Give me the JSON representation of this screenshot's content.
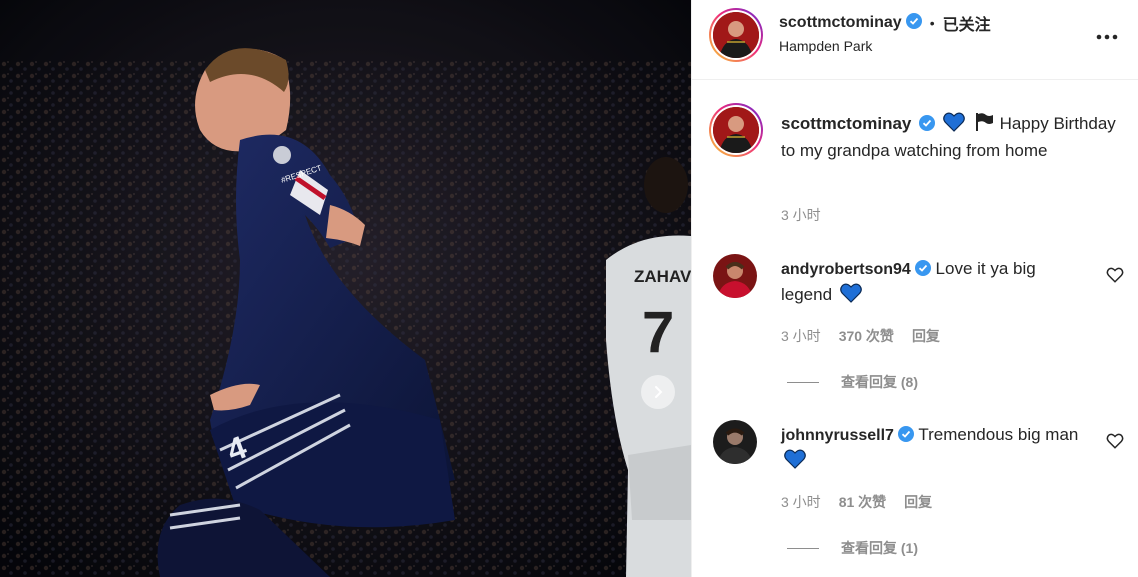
{
  "post": {
    "username": "scottmctominay",
    "follow_status": "已关注",
    "separator": "•",
    "location": "Hampden Park",
    "more_icon": "more-horizontal-icon",
    "photo_text": {
      "player_number": "4",
      "badge_text": "#RESPECT",
      "background_player_name": "ZAHAVI",
      "background_player_number": "7"
    }
  },
  "caption": {
    "username": "scottmctominay",
    "text": "Happy Birthday to my grandpa watching from home",
    "time": "3 小时"
  },
  "comments": [
    {
      "username": "andyrobertson94",
      "text": "Love it ya big legend",
      "time": "3 小时",
      "likes": "370 次赞",
      "reply": "回复",
      "view_replies": "查看回复 (8)"
    },
    {
      "username": "johnnyrussell7",
      "text": "Tremendous big man",
      "time": "3 小时",
      "likes": "81 次赞",
      "reply": "回复",
      "view_replies": "查看回复 (1)"
    }
  ],
  "colors": {
    "verified_blue": "#3897f0",
    "heart_blue": "#1f6fd6",
    "muted_text": "#8e8e8e",
    "text": "#262626"
  }
}
